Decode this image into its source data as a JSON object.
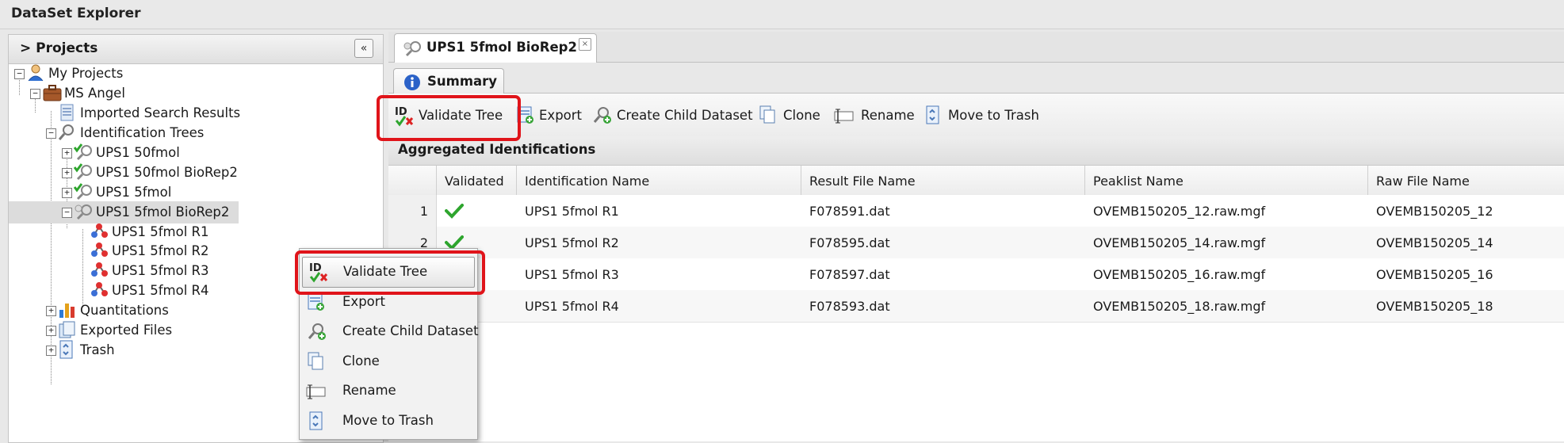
{
  "window": {
    "title": "DataSet Explorer"
  },
  "projects_panel": {
    "title": "> Projects",
    "collapse_glyph": "«",
    "tree": [
      {
        "label": "My Projects",
        "icon": "user-icon",
        "expander": "−"
      },
      {
        "label": "MS Angel",
        "icon": "briefcase-icon",
        "expander": "−"
      },
      {
        "label": "Imported Search Results",
        "icon": "document-icon",
        "expander": ""
      },
      {
        "label": "Identification Trees",
        "icon": "magnifier-icon",
        "expander": "−"
      },
      {
        "label": "UPS1 50fmol",
        "icon": "validated-dataset-icon",
        "expander": "+"
      },
      {
        "label": "UPS1 50fmol BioRep2",
        "icon": "validated-dataset-icon",
        "expander": "+"
      },
      {
        "label": "UPS1 5fmol",
        "icon": "validated-dataset-icon",
        "expander": "+"
      },
      {
        "label": "UPS1 5fmol BioRep2",
        "icon": "dataset-icon",
        "expander": "−"
      },
      {
        "label": "UPS1 5fmol R1",
        "icon": "identification-icon",
        "expander": ""
      },
      {
        "label": "UPS1 5fmol R2",
        "icon": "identification-icon",
        "expander": ""
      },
      {
        "label": "UPS1 5fmol R3",
        "icon": "identification-icon",
        "expander": ""
      },
      {
        "label": "UPS1 5fmol R4",
        "icon": "identification-icon",
        "expander": ""
      },
      {
        "label": "Quantitations",
        "icon": "bar-chart-icon",
        "expander": "+"
      },
      {
        "label": "Exported Files",
        "icon": "files-icon",
        "expander": "+"
      },
      {
        "label": "Trash",
        "icon": "trash-icon",
        "expander": "+"
      }
    ]
  },
  "document_tab": {
    "title": "UPS1 5fmol BioRep2",
    "close_glyph": "×"
  },
  "summary_tab": {
    "label": "Summary"
  },
  "toolbar": {
    "validate_id_glyph": "ID",
    "buttons": [
      {
        "label": "Validate Tree",
        "icon": "validate-icon"
      },
      {
        "label": "Export",
        "icon": "export-icon"
      },
      {
        "label": "Create Child Dataset",
        "icon": "create-child-icon"
      },
      {
        "label": "Clone",
        "icon": "clone-icon"
      },
      {
        "label": "Rename",
        "icon": "rename-icon"
      },
      {
        "label": "Move to Trash",
        "icon": "trash-icon"
      }
    ]
  },
  "aggregated": {
    "title": "Aggregated Identifications",
    "columns": [
      "Validated",
      "Identification Name",
      "Result File Name",
      "Peaklist Name",
      "Raw File Name"
    ],
    "rows": [
      {
        "num": "1",
        "validated": true,
        "name": "UPS1 5fmol R1",
        "result_file": "F078591.dat",
        "peaklist": "OVEMB150205_12.raw.mgf",
        "raw_file": "OVEMB150205_12"
      },
      {
        "num": "2",
        "validated": true,
        "name": "UPS1 5fmol R2",
        "result_file": "F078595.dat",
        "peaklist": "OVEMB150205_14.raw.mgf",
        "raw_file": "OVEMB150205_14"
      },
      {
        "num": "",
        "validated": false,
        "name": "UPS1 5fmol R3",
        "result_file": "F078597.dat",
        "peaklist": "OVEMB150205_16.raw.mgf",
        "raw_file": "OVEMB150205_16"
      },
      {
        "num": "",
        "validated": false,
        "name": "UPS1 5fmol R4",
        "result_file": "F078593.dat",
        "peaklist": "OVEMB150205_18.raw.mgf",
        "raw_file": "OVEMB150205_18"
      }
    ]
  },
  "context_menu": {
    "items": [
      {
        "label": "Validate Tree",
        "icon": "validate-icon",
        "highlighted": true
      },
      {
        "label": "Export",
        "icon": "export-icon"
      },
      {
        "label": "Create Child Dataset",
        "icon": "create-child-icon"
      },
      {
        "label": "Clone",
        "icon": "clone-icon"
      },
      {
        "label": "Rename",
        "icon": "rename-icon"
      },
      {
        "label": "Move to Trash",
        "icon": "trash-icon"
      }
    ]
  },
  "colors": {
    "highlight_red": "#e0141a",
    "check_green": "#2ea52e",
    "info_blue": "#2b62c8"
  }
}
